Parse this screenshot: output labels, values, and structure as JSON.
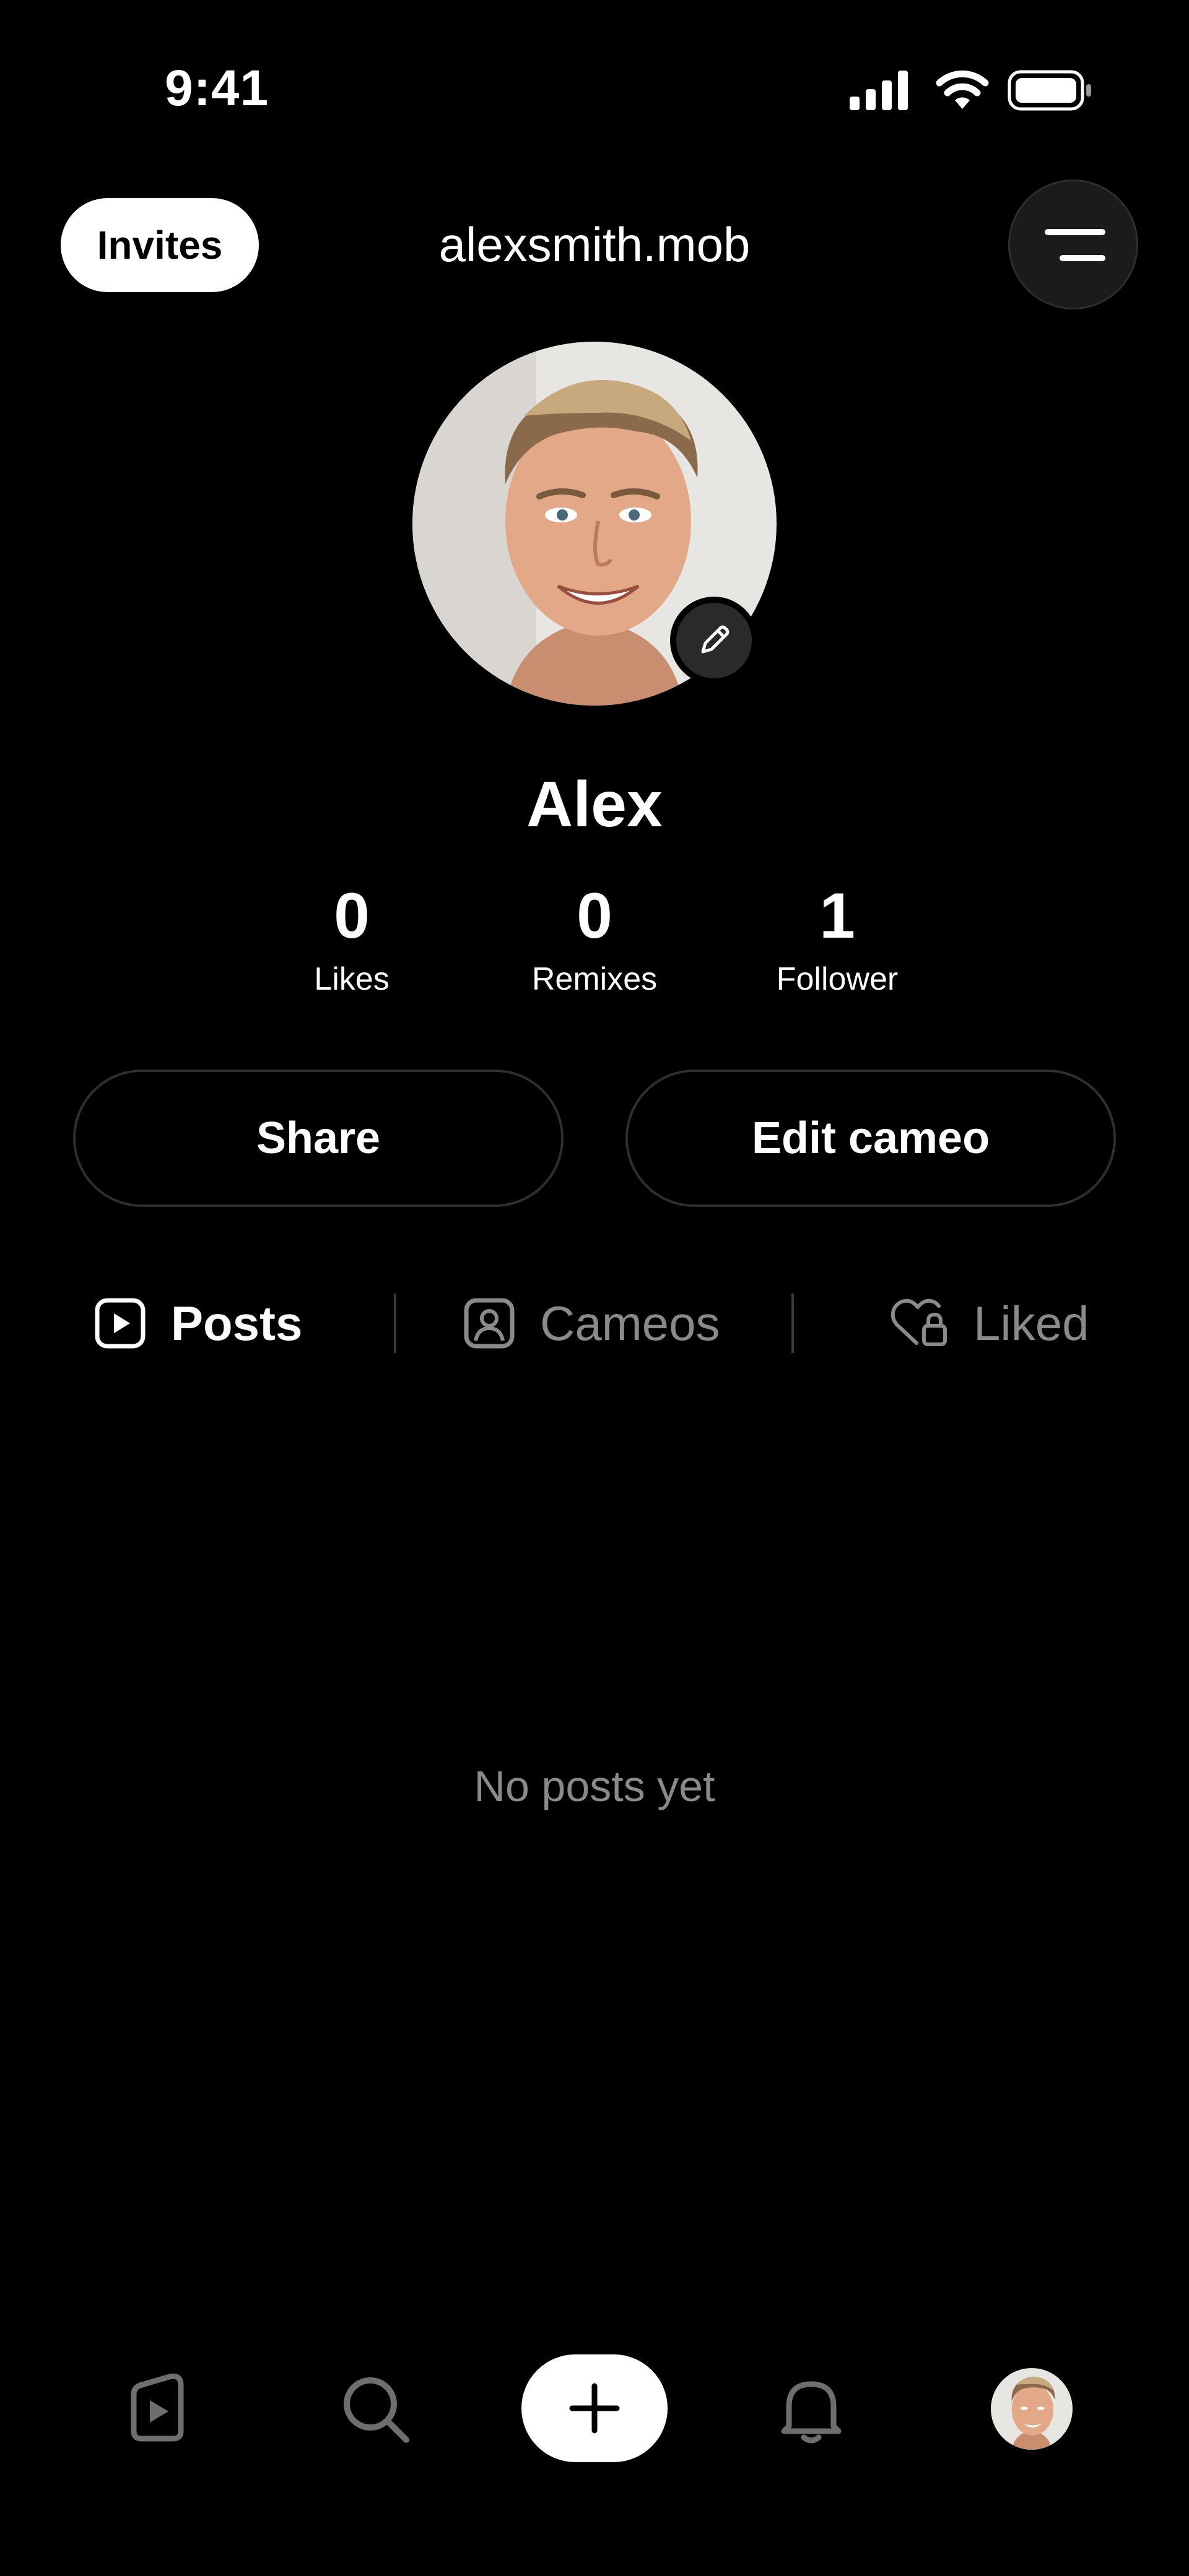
{
  "status_bar": {
    "time": "9:41",
    "icons": [
      "cellular-signal-icon",
      "wifi-icon",
      "battery-icon"
    ]
  },
  "header": {
    "invites_label": "Invites",
    "username": "alexsmith.mob",
    "menu_icon": "menu-icon"
  },
  "profile": {
    "display_name": "Alex",
    "avatar_icon": "avatar-photo",
    "edit_icon": "pencil-icon",
    "stats": [
      {
        "value": "0",
        "label": "Likes"
      },
      {
        "value": "0",
        "label": "Remixes"
      },
      {
        "value": "1",
        "label": "Follower"
      }
    ]
  },
  "actions": {
    "share_label": "Share",
    "edit_cameo_label": "Edit cameo"
  },
  "tabs": [
    {
      "label": "Posts",
      "icon": "play-square-icon",
      "active": true
    },
    {
      "label": "Cameos",
      "icon": "person-portrait-icon",
      "active": false
    },
    {
      "label": "Liked",
      "icon": "heart-lock-icon",
      "active": false
    }
  ],
  "empty_state": "No posts yet",
  "bottom_nav": [
    {
      "name": "feed",
      "icon": "play-hexagon-icon"
    },
    {
      "name": "search",
      "icon": "search-icon"
    },
    {
      "name": "create",
      "icon": "plus-icon"
    },
    {
      "name": "notifications",
      "icon": "bell-icon"
    },
    {
      "name": "profile",
      "icon": "avatar-photo"
    }
  ],
  "colors": {
    "background": "#000000",
    "text_primary": "#ffffff",
    "text_secondary": "#8a8a8a",
    "border": "#2e2e2e"
  }
}
